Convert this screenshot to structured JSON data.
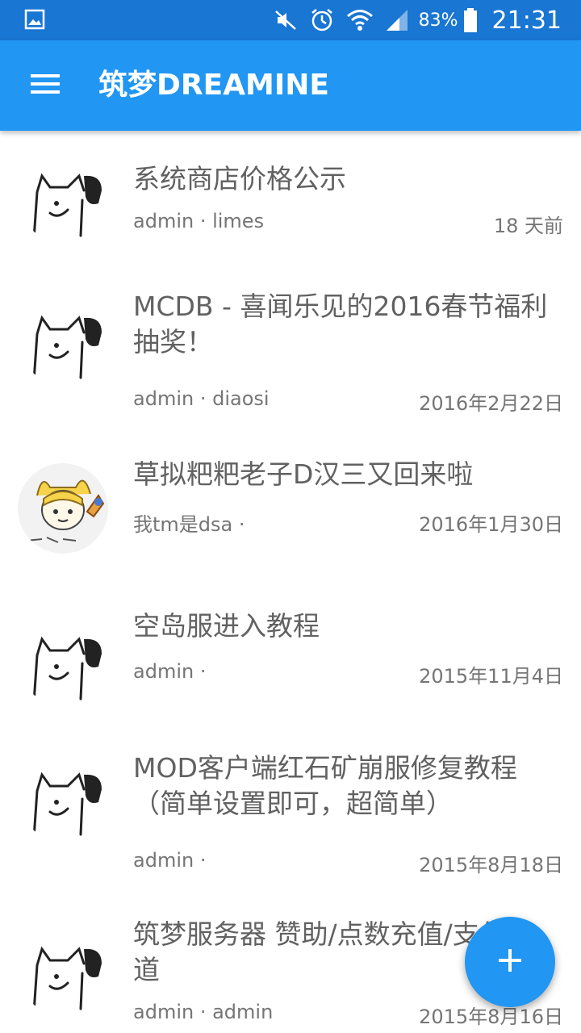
{
  "status_bar": {
    "battery_percent": "83%",
    "time": "21:31",
    "icons": [
      "gallery-icon",
      "mute-icon",
      "alarm-icon",
      "wifi-icon",
      "signal-icon",
      "battery-icon"
    ]
  },
  "app_bar": {
    "title": "筑梦DREAMINE",
    "menu_icon": "hamburger-menu-icon"
  },
  "posts": [
    {
      "title": "系统商店价格公示",
      "meta": "admin · limes",
      "date": "18 天前",
      "avatar": "dog-sketch"
    },
    {
      "title": "MCDB - 喜闻乐见的2016春节福利\n抽奖！",
      "meta": "admin · diaosi",
      "date": "2016年2月22日",
      "avatar": "dog-sketch"
    },
    {
      "title": "草拟粑粑老子D汉三又回来啦",
      "meta": "我tm是dsa ·",
      "date": "2016年1月30日",
      "avatar": "anime-character"
    },
    {
      "title": "空岛服进入教程",
      "meta": "admin ·",
      "date": "2015年11月4日",
      "avatar": "dog-sketch"
    },
    {
      "title": "MOD客户端红石矿崩服修复教程\n（简单设置即可，超简单）",
      "meta": "admin ·",
      "date": "2015年8月18日",
      "avatar": "dog-sketch"
    },
    {
      "title": "筑梦服务器 赞助/点数充值/支付通\n道",
      "meta": "admin · admin",
      "date": "2015年8月16日",
      "avatar": "dog-sketch"
    }
  ],
  "fab": {
    "icon": "plus-icon"
  }
}
